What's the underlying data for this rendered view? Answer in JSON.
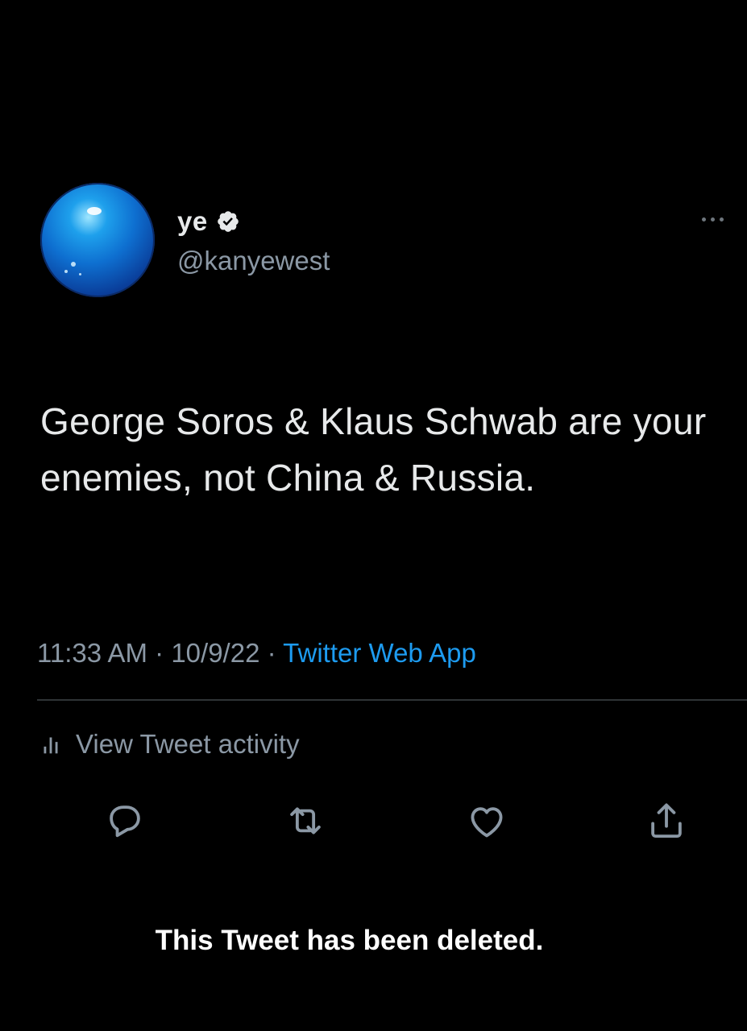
{
  "colors": {
    "background": "#000000",
    "primary_text": "#e7e9ea",
    "secondary_text": "#8b98a5",
    "accent_link": "#1d9bf0",
    "divider": "#2f3336"
  },
  "author": {
    "display_name": "ye",
    "handle": "@kanyewest",
    "verified": true
  },
  "tweet": {
    "text": "George Soros & Klaus Schwab are your enemies, not China & Russia.",
    "time": "11:33 AM",
    "separator": "·",
    "date": "10/9/22",
    "source": "Twitter Web App"
  },
  "activity": {
    "label": "View Tweet activity"
  },
  "actions": [
    {
      "name": "reply",
      "icon": "reply-icon"
    },
    {
      "name": "retweet",
      "icon": "retweet-icon"
    },
    {
      "name": "like",
      "icon": "heart-icon"
    },
    {
      "name": "share",
      "icon": "share-icon"
    }
  ],
  "overlay": {
    "deleted_notice": "This Tweet has been deleted."
  }
}
